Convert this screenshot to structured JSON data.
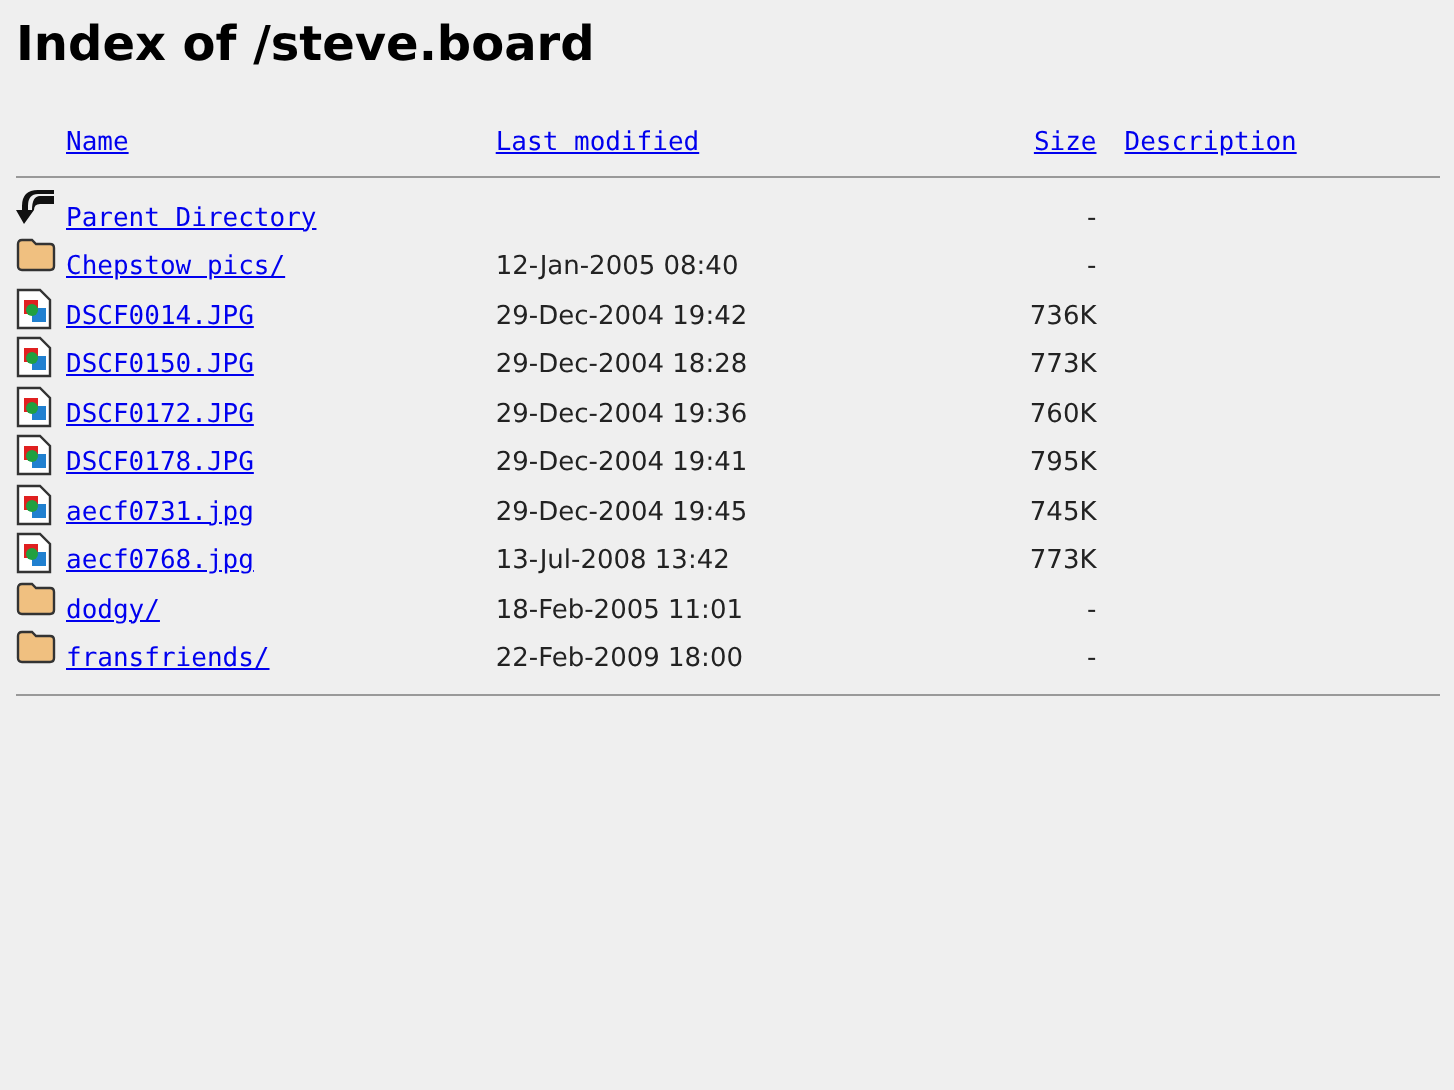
{
  "title": "Index of /steve.board",
  "columns": [
    "Name",
    "Last modified",
    "Size",
    "Description"
  ],
  "rows": [
    {
      "kind": "parent",
      "name": "Parent Directory",
      "modified": "",
      "size": "-"
    },
    {
      "kind": "folder",
      "name": "Chepstow pics/",
      "modified": "12-Jan-2005 08:40",
      "size": "-"
    },
    {
      "kind": "image",
      "name": "DSCF0014.JPG",
      "modified": "29-Dec-2004 19:42",
      "size": "736K"
    },
    {
      "kind": "image",
      "name": "DSCF0150.JPG",
      "modified": "29-Dec-2004 18:28",
      "size": "773K"
    },
    {
      "kind": "image",
      "name": "DSCF0172.JPG",
      "modified": "29-Dec-2004 19:36",
      "size": "760K"
    },
    {
      "kind": "image",
      "name": "DSCF0178.JPG",
      "modified": "29-Dec-2004 19:41",
      "size": "795K"
    },
    {
      "kind": "image",
      "name": "aecf0731.jpg",
      "modified": "29-Dec-2004 19:45",
      "size": "745K"
    },
    {
      "kind": "image",
      "name": "aecf0768.jpg",
      "modified": "13-Jul-2008 13:42",
      "size": "773K"
    },
    {
      "kind": "folder",
      "name": "dodgy/",
      "modified": "18-Feb-2005 11:01",
      "size": "-"
    },
    {
      "kind": "folder",
      "name": "fransfriends/",
      "modified": "22-Feb-2009 18:00",
      "size": "-"
    }
  ]
}
